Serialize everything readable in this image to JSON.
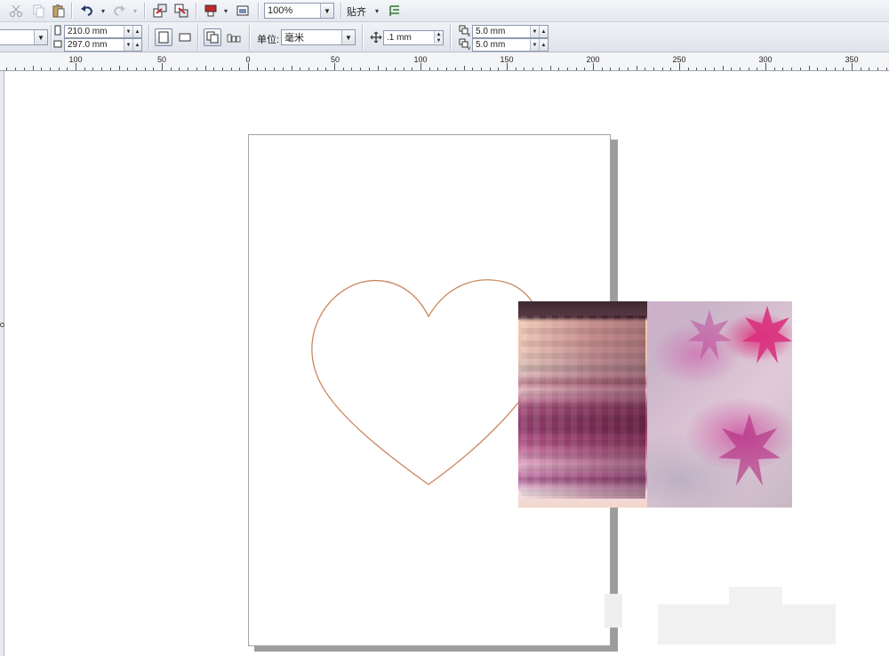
{
  "toolbar": {
    "zoom_value": "100%",
    "snap_label": "贴齐",
    "icons": [
      "cut-icon",
      "copy-icon",
      "paste-icon",
      "undo-icon",
      "redo-icon",
      "import-icon",
      "export-icon",
      "publish-icon",
      "app-launcher-icon",
      "snap-options-icon"
    ]
  },
  "property_bar": {
    "page_width": "210.0 mm",
    "page_height": "297.0 mm",
    "units_label": "单位:",
    "units_value": "毫米",
    "nudge_value": ".1 mm",
    "duplicate_x": "5.0 mm",
    "duplicate_y": "5.0 mm"
  },
  "ruler": {
    "labels": [
      "100",
      "50",
      "0",
      "50",
      "100",
      "150",
      "200",
      "250",
      "300",
      "350"
    ]
  },
  "canvas": {
    "outline_color": "#c9875f",
    "page_color": "#ffffff",
    "shadow_color": "#9d9d9d"
  },
  "colors": {
    "accent_pink": "#d9327e",
    "toolbar_bg": "#e6e9ef"
  }
}
